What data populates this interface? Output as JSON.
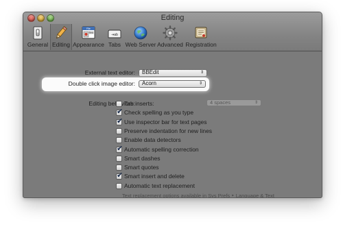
{
  "window": {
    "title": "Editing"
  },
  "toolbar": {
    "items": [
      {
        "label": "General",
        "icon": "light-switch-icon"
      },
      {
        "label": "Editing",
        "icon": "pencil-icon",
        "selected": true
      },
      {
        "label": "Appearance",
        "icon": "appearance-icon"
      },
      {
        "label": "Tabs",
        "icon": "tabs-icon"
      },
      {
        "label": "Web Server",
        "icon": "globe-icon"
      },
      {
        "label": "Advanced",
        "icon": "gear-icon"
      },
      {
        "label": "Registration",
        "icon": "registration-icon"
      }
    ]
  },
  "editors": {
    "external_label": "External text editor:",
    "external_value": "BBEdit",
    "image_label": "Double click image editor:",
    "image_value": "Acorn"
  },
  "behaviors": {
    "label": "Editing behaviors:",
    "items": [
      {
        "label": "Tab inserts:",
        "checked": false
      },
      {
        "label": "Check spelling as you type",
        "checked": true
      },
      {
        "label": "Use inspector bar for text pages",
        "checked": true
      },
      {
        "label": "Preserve indentation for new lines",
        "checked": false
      },
      {
        "label": "Enable data detectors",
        "checked": false
      },
      {
        "label": "Automatic spelling correction",
        "checked": true
      },
      {
        "label": "Smart dashes",
        "checked": false
      },
      {
        "label": "Smart quotes",
        "checked": false
      },
      {
        "label": "Smart insert and delete",
        "checked": true
      },
      {
        "label": "Automatic text replacement",
        "checked": false
      }
    ],
    "tab_spaces_value": "4 spaces",
    "replacement_hint": "Text replacement options available in Sys Prefs ‣ Language & Text"
  },
  "colors": {
    "window_bg": "#7b7b7b",
    "highlight": "#fbfbfb",
    "check": "#1a2b4a"
  }
}
